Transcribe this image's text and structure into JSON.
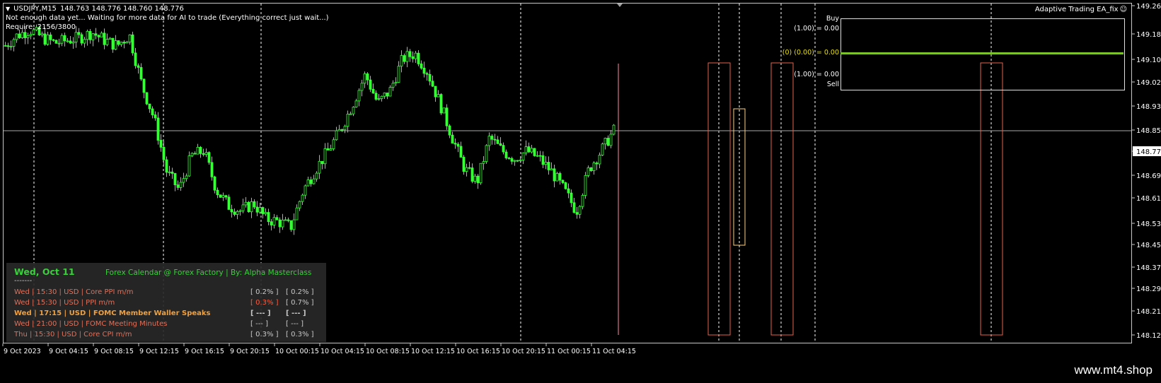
{
  "symbol_info": {
    "symbol": "USDJPY,M15",
    "ohlc": "148.763 148.776 148.760 148.776",
    "status": "Not enough data yet... Waiting for more data for AI to trade (Everything correct just wait...)",
    "require": "Require: 2156/3800"
  },
  "ea_name": "Adaptive Trading EA_fix",
  "ai_panel": {
    "buy_label": "Buy",
    "sell_label": "Sell",
    "buy_value": "(1.00) = 0.00",
    "mid_value": "(0) (0.00) = 0.00",
    "sell_value": "(1.00) = 0.00"
  },
  "price_axis": {
    "ticks": [
      "149.260",
      "149.180",
      "149.100",
      "149.020",
      "148.935",
      "148.850",
      "148.776",
      "148.690",
      "148.610",
      "148.530",
      "148.450",
      "148.370",
      "148.290",
      "148.210",
      "148.125"
    ],
    "current": "148.776"
  },
  "time_axis": {
    "ticks": [
      "9 Oct 2023",
      "9 Oct 04:15",
      "9 Oct 08:15",
      "9 Oct 12:15",
      "9 Oct 16:15",
      "9 Oct 20:15",
      "10 Oct 00:15",
      "10 Oct 04:15",
      "10 Oct 08:15",
      "10 Oct 12:15",
      "10 Oct 16:15",
      "10 Oct 20:15",
      "11 Oct 00:15",
      "11 Oct 04:15"
    ]
  },
  "calendar": {
    "date": "Wed, Oct 11",
    "title": "Forex Calendar @ Forex Factory | By: Alpha Masterclass",
    "separator": "-------",
    "events": [
      {
        "text": "Wed  |  15:30  |  USD  |  Core PPI m/m",
        "actual": "[ 0.2% ]",
        "forecast": "[ 0.2% ]",
        "color": "#e0705a",
        "actual_color": "#c8c8c8"
      },
      {
        "text": "Wed  |  15:30  |  USD  |  PPI m/m",
        "actual": "[ 0.3% ]",
        "forecast": "[ 0.7% ]",
        "color": "#e0705a",
        "actual_color": "#ff5a3c"
      },
      {
        "text": "Wed  |  17:15  |  USD  |  FOMC Member Waller Speaks",
        "actual": "[ --- ]",
        "forecast": "[ --- ]",
        "color": "#f0a03c",
        "actual_color": "#c8c8c8"
      },
      {
        "text": "Wed  |  21:00  |  USD  |  FOMC Meeting Minutes",
        "actual": "[ --- ]",
        "forecast": "[ --- ]",
        "color": "#e0705a",
        "actual_color": "#c8c8c8"
      },
      {
        "text": "Thu  |  15:30  |  USD  |  Core CPI m/m",
        "actual": "[ 0.3% ]",
        "forecast": "[ 0.3% ]",
        "color": "#e0705a",
        "actual_color": "#c8c8c8"
      }
    ]
  },
  "chart_data": {
    "type": "candlestick",
    "symbol": "USDJPY",
    "timeframe": "M15",
    "ylim": [
      148.125,
      149.26
    ],
    "current_price": 148.776,
    "close_path": [
      149.1,
      149.14,
      149.16,
      149.13,
      149.11,
      149.12,
      149.13,
      149.15,
      149.12,
      149.1,
      149.14,
      148.95,
      148.82,
      148.62,
      148.55,
      148.68,
      148.7,
      148.55,
      148.49,
      148.47,
      148.5,
      148.44,
      148.43,
      148.41,
      148.55,
      148.63,
      148.7,
      148.78,
      148.88,
      148.99,
      148.88,
      148.93,
      149.05,
      149.07,
      149.0,
      148.88,
      148.75,
      148.63,
      148.58,
      148.75,
      148.7,
      148.67,
      148.7,
      148.67,
      148.62,
      148.55,
      148.47,
      148.63,
      148.7,
      148.776
    ],
    "colors": {
      "candle": "#38ff38",
      "grid": "#ffffff",
      "box": "#e8604a",
      "box2": "#ffd080",
      "pink_line": "#ff8aa0"
    }
  },
  "watermark": "www.mt4.shop"
}
